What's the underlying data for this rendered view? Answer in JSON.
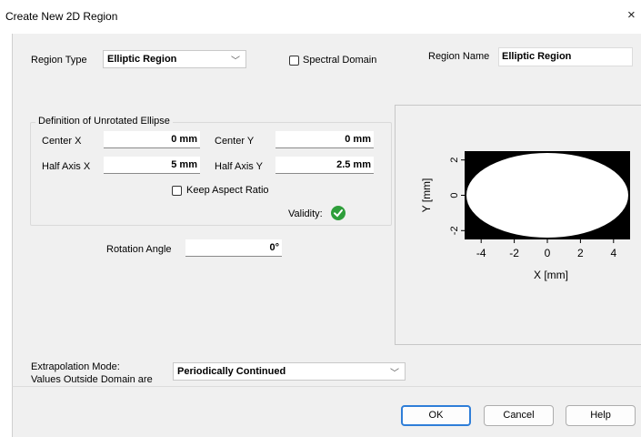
{
  "window": {
    "title": "Create New 2D Region",
    "close_glyph": "×"
  },
  "region_type": {
    "label": "Region Type",
    "value": "Elliptic Region"
  },
  "spectral_domain": {
    "label": "Spectral Domain",
    "checked": false
  },
  "region_name": {
    "label": "Region Name",
    "value": "Elliptic Region"
  },
  "ellipse": {
    "group_title": "Definition of Unrotated Ellipse",
    "center_x": {
      "label": "Center X",
      "value": "0 mm"
    },
    "center_y": {
      "label": "Center Y",
      "value": "0 mm"
    },
    "half_axis_x": {
      "label": "Half Axis X",
      "value": "5 mm"
    },
    "half_axis_y": {
      "label": "Half Axis Y",
      "value": "2.5 mm"
    },
    "keep_aspect": {
      "label": "Keep Aspect Ratio",
      "checked": false
    },
    "validity": {
      "label": "Validity:",
      "state": "valid",
      "color": "#2e9e3a"
    }
  },
  "rotation": {
    "label": "Rotation Angle",
    "value": "0°"
  },
  "preview": {
    "x_label": "X [mm]",
    "y_label": "Y [mm]",
    "x_ticks": [
      "-4",
      "-2",
      "0",
      "2",
      "4"
    ],
    "y_ticks": [
      "2",
      "0",
      "-2"
    ]
  },
  "chart_data": {
    "type": "area",
    "shape": "ellipse",
    "center": [
      0,
      0
    ],
    "half_axes": [
      5,
      2.5
    ],
    "xlabel": "X [mm]",
    "ylabel": "Y [mm]",
    "xlim": [
      -5,
      5
    ],
    "ylim": [
      -2.5,
      2.5
    ],
    "x_ticks": [
      -4,
      -2,
      0,
      2,
      4
    ],
    "y_ticks": [
      2,
      0,
      -2
    ],
    "fill_color": "#ffffff",
    "background_color": "#000000"
  },
  "extrapolation": {
    "label_line1": "Extrapolation Mode:",
    "label_line2": "Values Outside Domain are",
    "value": "Periodically Continued"
  },
  "buttons": {
    "ok": "OK",
    "cancel": "Cancel",
    "help": "Help"
  },
  "colors": {
    "dialog_bg": "#f0f0f0",
    "default_button_border": "#2f7ed8"
  }
}
